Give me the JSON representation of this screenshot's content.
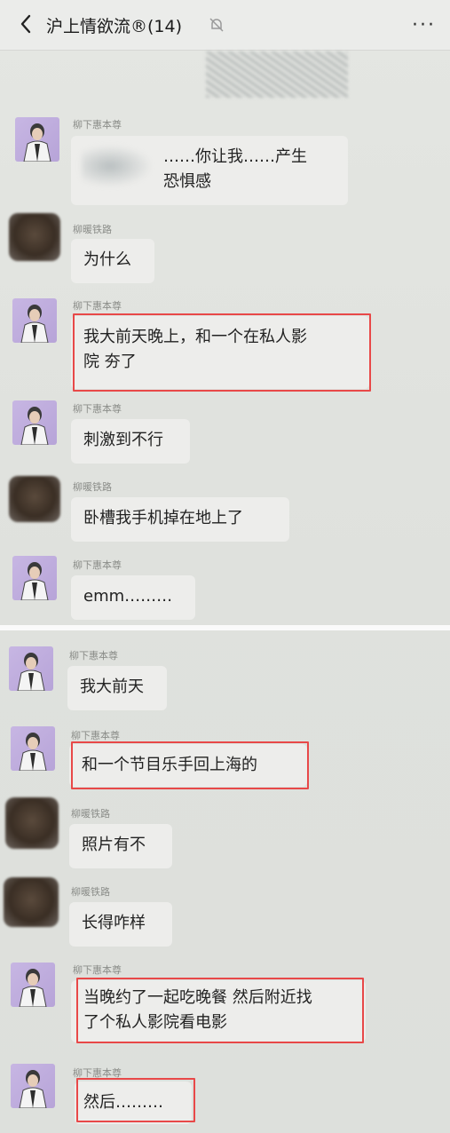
{
  "header": {
    "title": "沪上情欲流®(14)",
    "more_label": "···"
  },
  "names": {
    "a": "柳下惠本尊",
    "b": "柳暖铁路"
  },
  "messages": [
    {
      "text": "……你让我……产生\n恐惧感"
    },
    {
      "text": "为什么"
    },
    {
      "text": "我大前天晚上，和一个在私人影\n院 夯了"
    },
    {
      "text": "刺激到不行"
    },
    {
      "text": "卧槽我手机掉在地上了"
    },
    {
      "text": "emm………"
    },
    {
      "text": "我大前天"
    },
    {
      "text": "和一个节目乐手回上海的"
    },
    {
      "text": "照片有不"
    },
    {
      "text": "长得咋样"
    },
    {
      "text": "当晚约了一起吃晚餐 然后附近找\n了个私人影院看电影"
    },
    {
      "text": "然后………"
    }
  ],
  "colors": {
    "highlight": "#e84848",
    "bubble": "#ededeb",
    "avatar_purple": "#c7b6e3"
  },
  "icons": [
    "back-chevron-icon",
    "mute-bell-icon",
    "more-dots-icon"
  ]
}
